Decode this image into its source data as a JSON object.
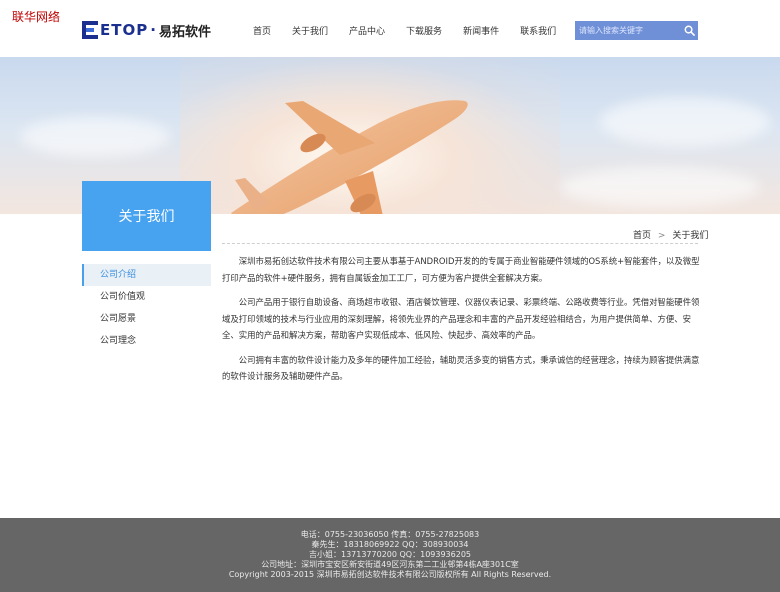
{
  "corner_tag": "联华网络",
  "logo": {
    "brand": "ETOP",
    "brand_cn": "易拓软件"
  },
  "nav": [
    "首页",
    "关于我们",
    "产品中心",
    "下载服务",
    "新闻事件",
    "联系我们"
  ],
  "search": {
    "placeholder": "请输入搜索关键字"
  },
  "sidebar": {
    "title": "关于我们",
    "items": [
      {
        "label": "公司介绍",
        "active": true
      },
      {
        "label": "公司价值观",
        "active": false
      },
      {
        "label": "公司愿景",
        "active": false
      },
      {
        "label": "公司理念",
        "active": false
      }
    ]
  },
  "breadcrumb": {
    "home": "首页",
    "separator": ">",
    "current": "关于我们"
  },
  "content": {
    "paragraphs": [
      "深圳市易拓创达软件技术有限公司主要从事基于ANDROID开发的的专属于商业智能硬件领域的OS系统+智能套件，以及微型打印产品的软件+硬件服务，拥有自属钣金加工工厂，可方便为客户提供全套解决方案。",
      "公司产品用于银行自助设备、商场超市收银、酒店餐饮管理、仪器仪表记录、彩票终端、公路收费等行业。凭借对智能硬件领域及打印领域的技术与行业应用的深刻理解，将领先业界的产品理念和丰富的产品开发经验相结合，为用户提供简单、方便、安全、实用的产品和解决方案，帮助客户实现低成本、低风险、快起步、高效率的产品。",
      "公司拥有丰富的软件设计能力及多年的硬件加工经验，辅助灵活多变的销售方式，秉承诚信的经营理念，持续为顾客提供满意的软件设计服务及辅助硬件产品。"
    ]
  },
  "footer": {
    "lines": [
      "电话：0755-23036050 传真：0755-27825083",
      "秦先生：18318069922 QQ：308930034",
      "吉小姐：13713770200 QQ：1093936205",
      "公司地址：深圳市宝安区新安街道49区河东第二工业邨第4栋A座301C室",
      "Copyright 2003-2015 深圳市易拓创达软件技术有限公司版权所有 All Rights Reserved."
    ]
  },
  "colors": {
    "accent": "#47a3f0",
    "search_bg": "#6f8fd6",
    "footer_bg": "#666666",
    "brand": "#1b2f8e"
  },
  "icons": {
    "search": "search-icon",
    "plane": "airplane-image"
  }
}
